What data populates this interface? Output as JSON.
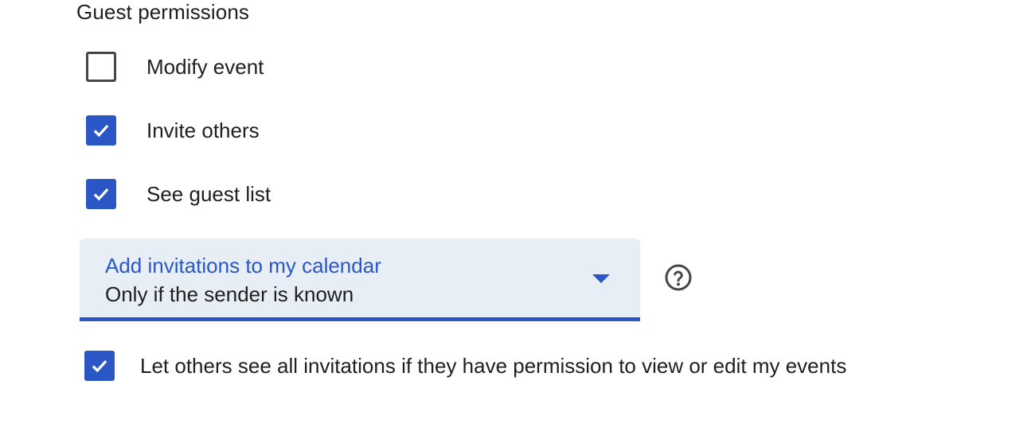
{
  "section": {
    "title": "Guest permissions"
  },
  "permissions": [
    {
      "label": "Modify event",
      "checked": false
    },
    {
      "label": "Invite others",
      "checked": true
    },
    {
      "label": "See guest list",
      "checked": true
    }
  ],
  "invitations_dropdown": {
    "label": "Add invitations to my calendar",
    "selected_value": "Only if the sender is known",
    "icon": "chevron-down-icon"
  },
  "help": {
    "icon": "help-circle-icon"
  },
  "visibility_option": {
    "label": "Let others see all invitations if they have permission to view or edit my events",
    "checked": true
  },
  "colors": {
    "accent": "#2a56c6",
    "dropdown_background": "#e8eef5",
    "text": "#1f1f1f",
    "unchecked_border": "#444746"
  }
}
